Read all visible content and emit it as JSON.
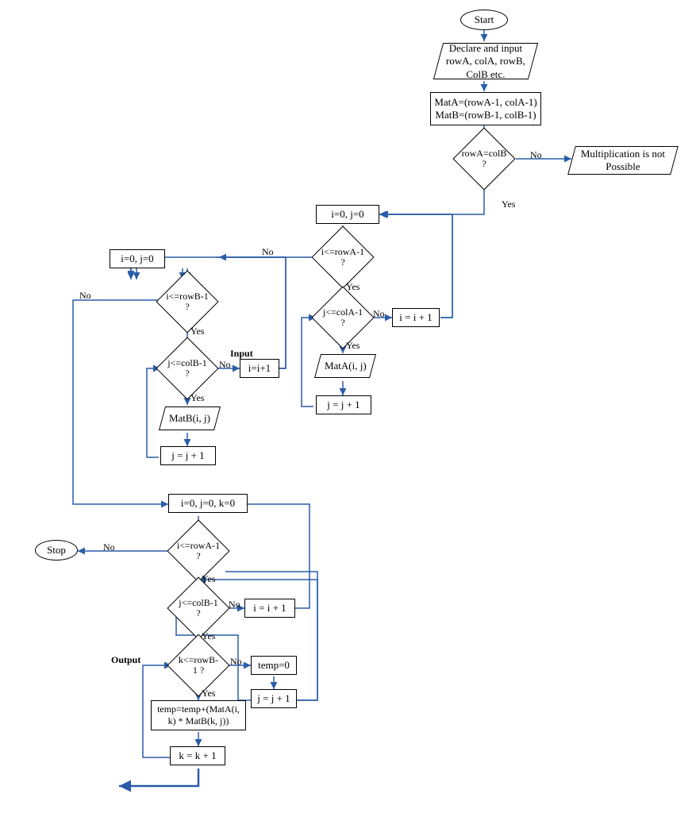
{
  "nodes": {
    "start": "Start",
    "declare": "Declare and input rowA, colA, rowB, ColB etc.",
    "matdef": "MatA=(rowA-1, colA-1) MatB=(rowB-1, colB-1)",
    "rowa_eq_colb": "rowA=colB ?",
    "mult_not_possible": "Multiplication is not Possible",
    "ij0_top": "i=0, j=0",
    "irowA1": "i<=rowA-1 ?",
    "jcolA1": "j<=colA-1 ?",
    "iinc1": "i = i + 1",
    "matA_io": "MatA(i, j)",
    "jinc1": "j = j + 1",
    "ij0_left": "i=0,  j=0",
    "irowB1": "i<=rowB-1 ?",
    "jcolB1": "j<=colB-1 ?",
    "iinc2": "i=i+1",
    "matB_io": "MatB(i, j)",
    "jinc2": "j = j + 1",
    "ijk0": "i=0, j=0, k=0",
    "irowA1_2": "i<=rowA-1 ?",
    "jcolB1_2": "j<=colB-1 ?",
    "krowB1": "k<=rowB-1 ?",
    "iinc3": "i = i + 1",
    "temp0": "temp=0",
    "jinc3": "j = j + 1",
    "tempformula": "temp=temp+(MatA(i, k) * MatB(k, j))",
    "kinc": "k = k + 1",
    "stop": "Stop"
  },
  "labels": {
    "yes": "Yes",
    "no": "No",
    "input": "Input",
    "output": "Output"
  },
  "colors": {
    "arrow": "#2a5ca8"
  }
}
